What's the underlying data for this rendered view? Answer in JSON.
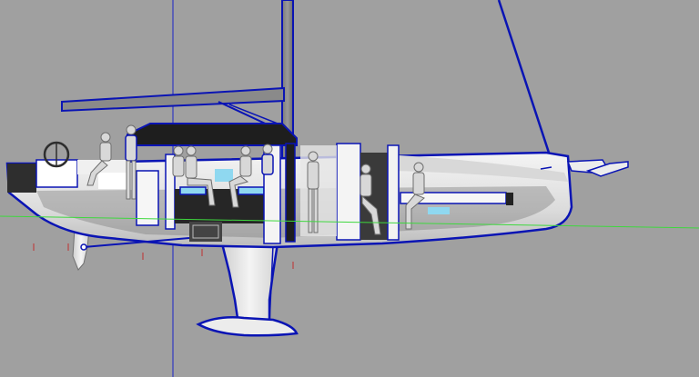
{
  "viewport": {
    "background": "#a0a0a0",
    "selection_color": "#0a14b4",
    "ground_line_color": "#3ed83e",
    "axis_color": "#1a24c8",
    "tick_color": "#c03030",
    "hull_color": "#f2f2f2",
    "shadow_color": "#2e2e2e",
    "glass_color": "#8fd8f0"
  },
  "scene": {
    "view": "side elevation",
    "objects": [
      "hull",
      "mast",
      "boom",
      "forestay",
      "keel-fin",
      "keel-bulb",
      "rudder",
      "bowsprit",
      "helm-wheel",
      "coachroof",
      "interior-bulkheads",
      "mannequin-figures"
    ],
    "figure_count": 9
  }
}
